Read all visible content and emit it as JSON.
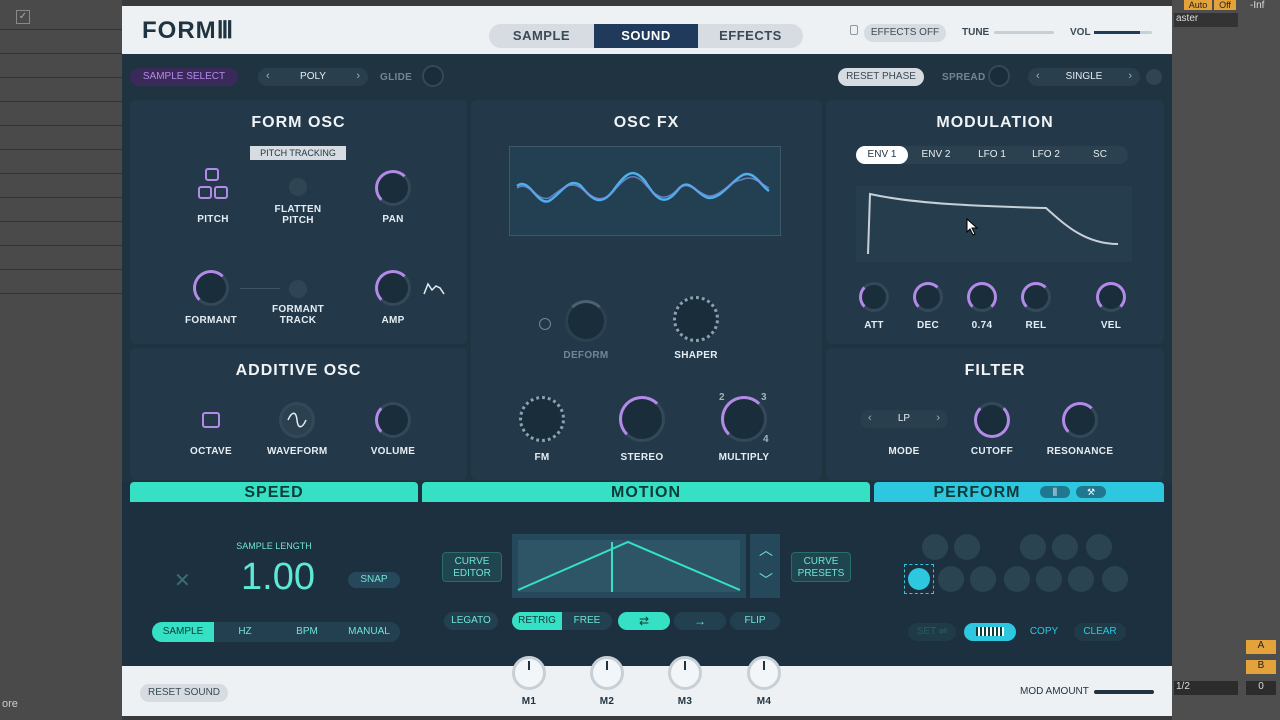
{
  "tabs": [
    "SAMPLE",
    "SOUND",
    "EFFECTS"
  ],
  "active_tab": "SOUND",
  "top_right": {
    "effects": "EFFECTS OFF",
    "tune": "TUNE",
    "vol": "VOL"
  },
  "row2": {
    "sample_select": "SAMPLE SELECT",
    "poly": "POLY",
    "glide": "GLIDE",
    "reset_phase": "RESET PHASE",
    "spread": "SPREAD",
    "single": "SINGLE"
  },
  "form_osc": {
    "title": "FORM OSC",
    "pitch_tracking": "PITCH TRACKING",
    "pitch": "PITCH",
    "flatten_pitch": [
      "FLATTEN",
      "PITCH"
    ],
    "pan": "PAN",
    "formant": "FORMANT",
    "formant_track": [
      "FORMANT",
      "TRACK"
    ],
    "amp": "AMP"
  },
  "additive_osc": {
    "title": "ADDITIVE OSC",
    "octave": "OCTAVE",
    "waveform": "WAVEFORM",
    "volume": "VOLUME"
  },
  "osc_fx": {
    "title": "OSC FX",
    "deform": "DEFORM",
    "shaper": "SHAPER",
    "fm": "FM",
    "stereo": "STEREO",
    "multiply": "MULTIPLY",
    "mult_nums": [
      "2",
      "3",
      "4"
    ]
  },
  "modulation": {
    "title": "MODULATION",
    "tabs": [
      "ENV 1",
      "ENV 2",
      "LFO 1",
      "LFO 2",
      "SC"
    ],
    "knobs": [
      "ATT",
      "DEC",
      "0.74",
      "REL",
      "VEL"
    ]
  },
  "filter": {
    "title": "FILTER",
    "mode_value": "LP",
    "mode": "MODE",
    "cutoff": "CUTOFF",
    "resonance": "RESONANCE"
  },
  "speed": {
    "title": "SPEED",
    "sample_length": "SAMPLE LENGTH",
    "value": "1.00",
    "snap": "SNAP",
    "modes": [
      "SAMPLE",
      "HZ",
      "BPM",
      "MANUAL"
    ]
  },
  "motion": {
    "title": "MOTION",
    "curve_editor": [
      "CURVE",
      "EDITOR"
    ],
    "curve_presets": [
      "CURVE",
      "PRESETS"
    ],
    "legato": "LEGATO",
    "retrig": "RETRIG",
    "free": "FREE",
    "flip": "FLIP"
  },
  "perform": {
    "title": "PERFORM",
    "set": "SET",
    "copy": "COPY",
    "clear": "CLEAR"
  },
  "bottom": {
    "reset_sound": "RESET SOUND",
    "macros": [
      "M1",
      "M2",
      "M3",
      "M4"
    ],
    "mod_amount": "MOD AMOUNT"
  },
  "host": {
    "auto": "Auto",
    "off": "Off",
    "inf": "-Inf",
    "master": "aster",
    "ratio": "1/2",
    "a": "A",
    "b": "B",
    "zero": "0",
    "ore": "ore"
  },
  "colors": {
    "accent_teal": "#35e0c4",
    "accent_cyan": "#2ec7e0",
    "accent_purple": "#b48ae8",
    "panel": "#23394a"
  }
}
